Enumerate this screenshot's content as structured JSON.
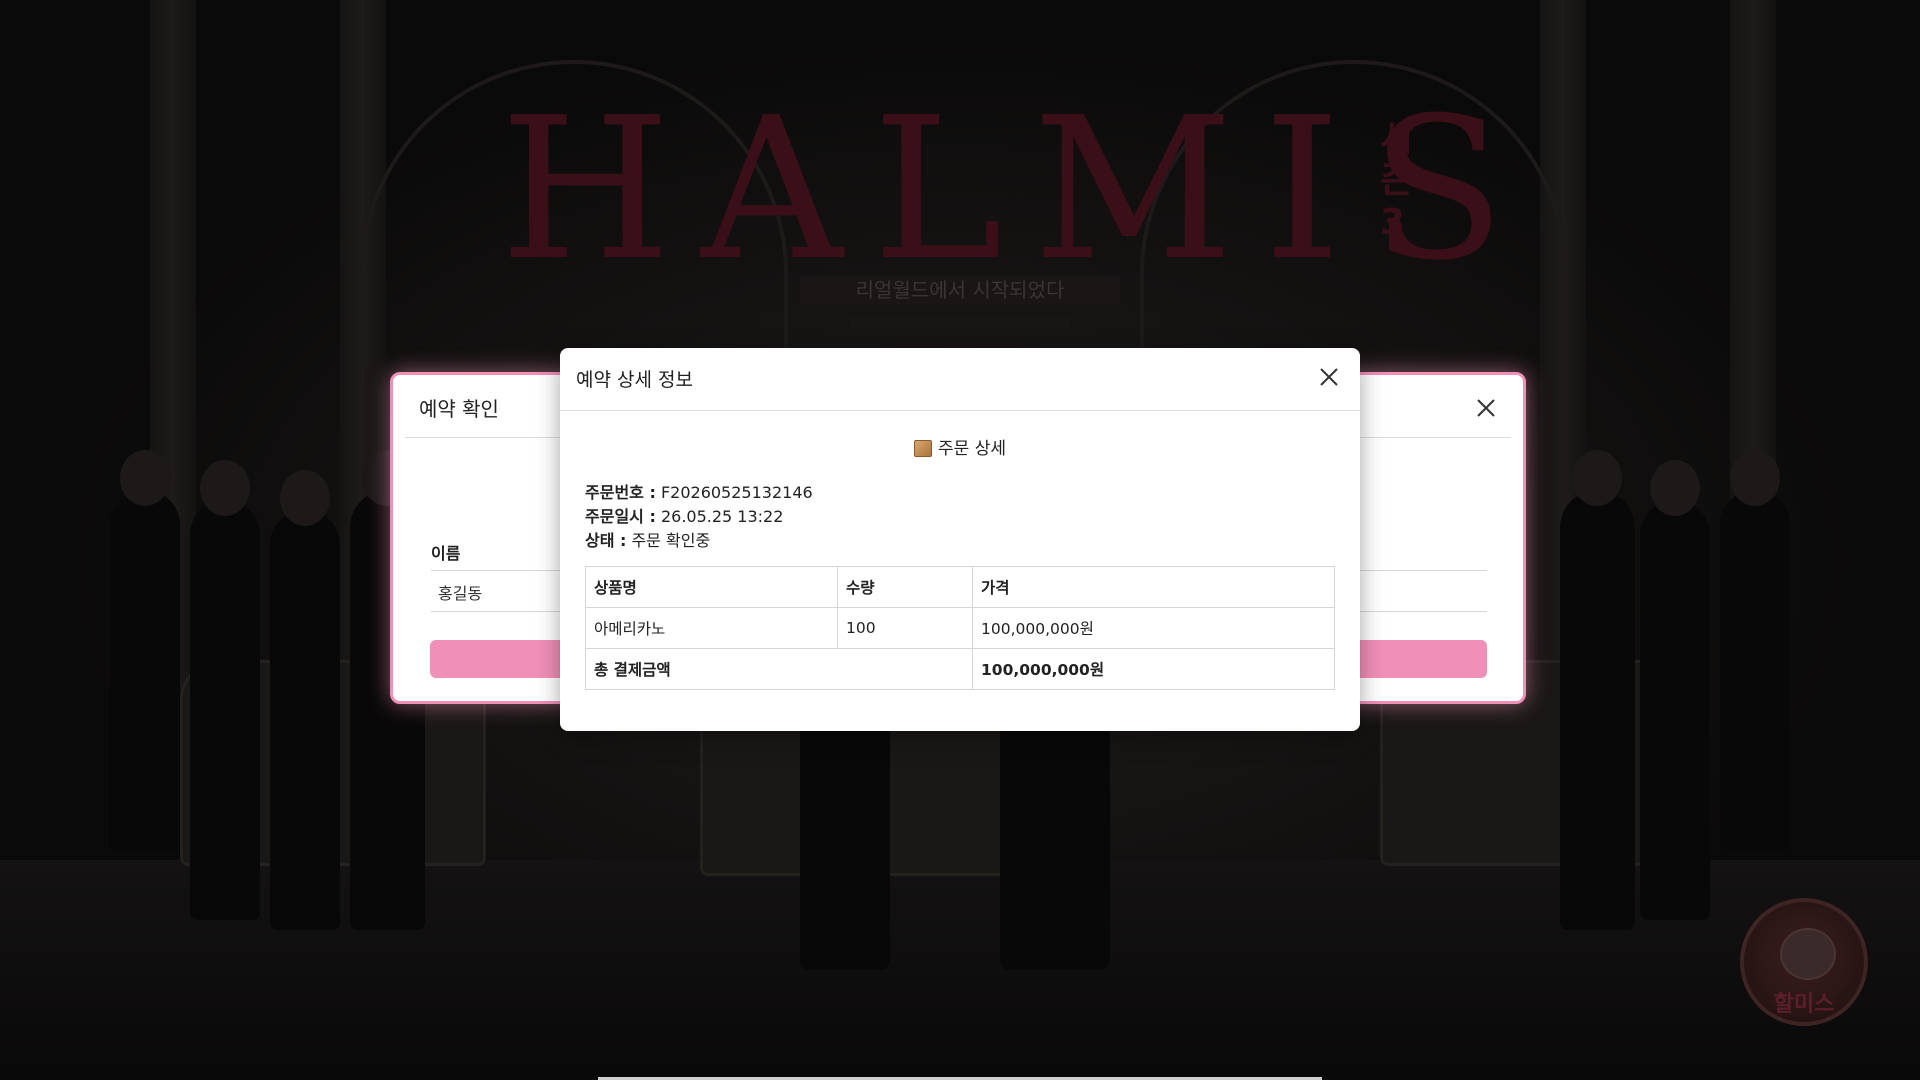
{
  "background": {
    "logo_text": "HALMIS",
    "logo_side_text": "시즌3",
    "tagline": "리얼월드에서 시작되었다"
  },
  "back_modal": {
    "title": "예약 확인",
    "table_header_name": "이름",
    "row_name": "홍길동",
    "accent_color": "#f08fb7"
  },
  "detail_modal": {
    "title": "예약 상세 정보",
    "section_title": "주문 상세",
    "order_number_label": "주문번호 :",
    "order_number": "F20260525132146",
    "order_date_label": "주문일시 :",
    "order_date": "26.05.25 13:22",
    "status_label": "상태 :",
    "status": "주문 확인중",
    "table": {
      "headers": [
        "상품명",
        "수량",
        "가격"
      ],
      "rows": [
        {
          "product": "아메리카노",
          "quantity": "100",
          "price": "100,000,000원"
        }
      ],
      "total_label": "총 결제금액",
      "total_value": "100,000,000원"
    }
  },
  "badge": {
    "label": "할미스"
  }
}
